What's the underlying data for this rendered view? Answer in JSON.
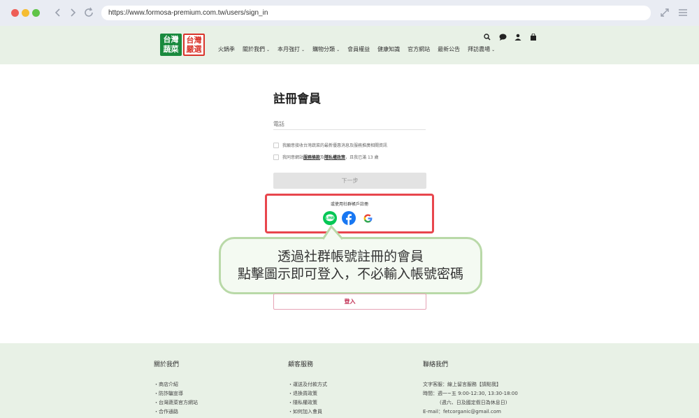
{
  "browser": {
    "url": "https://www.formosa-premium.com.tw/users/sign_in"
  },
  "header": {
    "logo_left": [
      "台灣",
      "蔬菜"
    ],
    "logo_right": [
      "台灣",
      "嚴選"
    ],
    "nav": [
      {
        "label": "火鍋季",
        "caret": false
      },
      {
        "label": "關於我們",
        "caret": true
      },
      {
        "label": "本月強打",
        "caret": true
      },
      {
        "label": "購物分類",
        "caret": true
      },
      {
        "label": "會員權益",
        "caret": false
      },
      {
        "label": "健康知識",
        "caret": false
      },
      {
        "label": "官方網站",
        "caret": false
      },
      {
        "label": "最新公告",
        "caret": false
      },
      {
        "label": "拜訪農場",
        "caret": true
      }
    ]
  },
  "form": {
    "title": "註冊會員",
    "phone_placeholder": "電話",
    "check1": "我願意接收台灣蔬菜的最新優惠消息及服務推廣相關資訊",
    "check2_prefix": "我同意網站",
    "terms_link": "服務條款",
    "and": "及",
    "privacy_link": "隱私權政策",
    "check2_suffix": "，且我已滿 13 歲",
    "next_label": "下一步",
    "social_label": "或使用社群帳戶註冊",
    "login_label": "登入"
  },
  "callout": {
    "line1": "透過社群帳號註冊的會員",
    "line2": "點擊圖示即可登入，不必輸入帳號密碼"
  },
  "footer": {
    "about_title": "關於我們",
    "about_items": [
      "・商店介紹",
      "・防詐騙宣導",
      "・台灣蔬菜官方網站",
      "・合作通路",
      "・..."
    ],
    "service_title": "顧客服務",
    "service_items": [
      "・運送及付款方式",
      "・退換貨政策",
      "・隱私權政策",
      "・如何加入會員",
      "・..."
    ],
    "contact_title": "聯絡我們",
    "contact_items": [
      "文字客服：線上留言服務【請點我】",
      "時間：週一~五 9:00-12:30, 13:30-18:00",
      "(週六、日及國定假日為休息日)",
      "E-mail：fetcorganic@gmail.com"
    ]
  },
  "colors": {
    "accent_red": "#e8464d",
    "line_green": "#06c755",
    "facebook_blue": "#1877f2",
    "callout_border": "#b9d9a8"
  }
}
